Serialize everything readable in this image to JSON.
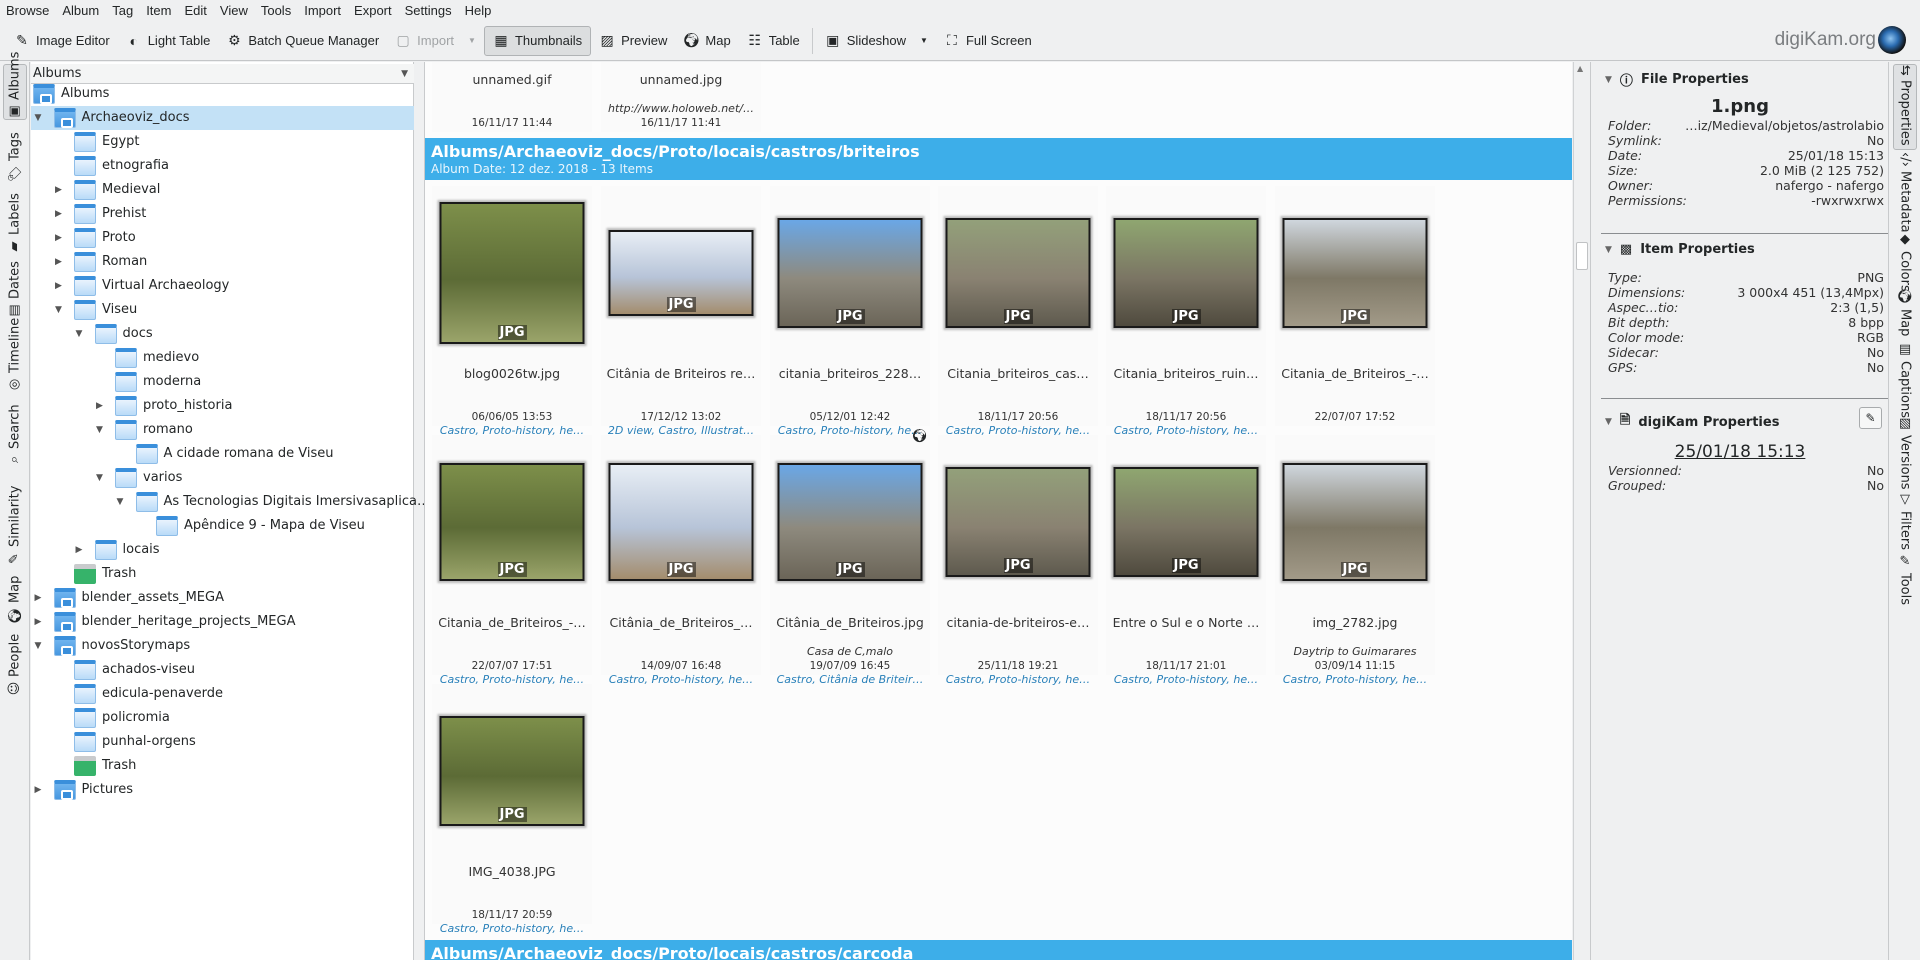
{
  "menu": [
    "Browse",
    "Album",
    "Tag",
    "Item",
    "Edit",
    "View",
    "Tools",
    "Import",
    "Export",
    "Settings",
    "Help"
  ],
  "toolbar": {
    "image_editor": "Image Editor",
    "light_table": "Light Table",
    "batch_queue": "Batch Queue Manager",
    "import": "Import",
    "thumbnails": "Thumbnails",
    "preview": "Preview",
    "map": "Map",
    "table": "Table",
    "slideshow": "Slideshow",
    "full_screen": "Full Screen",
    "logo_text": "digiKam.org"
  },
  "left_tabs": [
    "Albums",
    "Tags",
    "Labels",
    "Dates",
    "Timeline",
    "Search",
    "Similarity",
    "Map",
    "People"
  ],
  "tree": {
    "combo": "Albums",
    "items": [
      {
        "label": "Albums",
        "level": 0,
        "exp": "",
        "icon": "root"
      },
      {
        "label": "Archaeoviz_docs",
        "level": 1,
        "exp": "open",
        "icon": "root",
        "selected": true
      },
      {
        "label": "Egypt",
        "level": 2,
        "exp": "",
        "icon": "folder"
      },
      {
        "label": "etnografia",
        "level": 2,
        "exp": "",
        "icon": "folder"
      },
      {
        "label": "Medieval",
        "level": 2,
        "exp": "closed",
        "icon": "folder"
      },
      {
        "label": "Prehist",
        "level": 2,
        "exp": "closed",
        "icon": "folder"
      },
      {
        "label": "Proto",
        "level": 2,
        "exp": "closed",
        "icon": "folder"
      },
      {
        "label": "Roman",
        "level": 2,
        "exp": "closed",
        "icon": "folder"
      },
      {
        "label": "Virtual Archaeology",
        "level": 2,
        "exp": "closed",
        "icon": "folder"
      },
      {
        "label": "Viseu",
        "level": 2,
        "exp": "open",
        "icon": "folder"
      },
      {
        "label": "docs",
        "level": 3,
        "exp": "open",
        "icon": "folder"
      },
      {
        "label": "medievo",
        "level": 4,
        "exp": "",
        "icon": "folder"
      },
      {
        "label": "moderna",
        "level": 4,
        "exp": "",
        "icon": "folder"
      },
      {
        "label": "proto_historia",
        "level": 4,
        "exp": "closed",
        "icon": "folder"
      },
      {
        "label": "romano",
        "level": 4,
        "exp": "open",
        "icon": "folder"
      },
      {
        "label": "A cidade romana de Viseu",
        "level": 5,
        "exp": "",
        "icon": "folder"
      },
      {
        "label": "varios",
        "level": 4,
        "exp": "open",
        "icon": "folder"
      },
      {
        "label": "As Tecnologias Digitais Imersivasaplica…",
        "level": 5,
        "exp": "open",
        "icon": "folder"
      },
      {
        "label": "Apêndice 9 - Mapa de Viseu",
        "level": 6,
        "exp": "",
        "icon": "folder"
      },
      {
        "label": "locais",
        "level": 3,
        "exp": "closed",
        "icon": "folder"
      },
      {
        "label": "Trash",
        "level": 2,
        "exp": "",
        "icon": "trash"
      },
      {
        "label": "blender_assets_MEGA",
        "level": 1,
        "exp": "closed",
        "icon": "root"
      },
      {
        "label": "blender_heritage_projects_MEGA",
        "level": 1,
        "exp": "closed",
        "icon": "root"
      },
      {
        "label": "novosStorymaps",
        "level": 1,
        "exp": "open",
        "icon": "root"
      },
      {
        "label": "achados-viseu",
        "level": 2,
        "exp": "",
        "icon": "folder"
      },
      {
        "label": "edicula-penaverde",
        "level": 2,
        "exp": "",
        "icon": "folder"
      },
      {
        "label": "policromia",
        "level": 2,
        "exp": "",
        "icon": "folder"
      },
      {
        "label": "punhal-orgens",
        "level": 2,
        "exp": "",
        "icon": "folder"
      },
      {
        "label": "Trash",
        "level": 2,
        "exp": "",
        "icon": "trash"
      },
      {
        "label": "Pictures",
        "level": 1,
        "exp": "closed",
        "icon": "root"
      }
    ]
  },
  "prev_items": [
    {
      "name": "unnamed.gif",
      "caption": "",
      "date": "16/11/17 11:44"
    },
    {
      "name": "unnamed.jpg",
      "caption": "http://www.holoweb.net/…",
      "date": "16/11/17 11:41"
    }
  ],
  "album": {
    "title": "Albums/Archaeoviz_docs/Proto/locais/castros/briteiros",
    "subtitle": "Album Date: 12 dez. 2018 - 13 Items",
    "items": [
      {
        "name": "blog0026tw.jpg",
        "caption": "",
        "date": "06/06/05 13:53",
        "tags": "Castro, Proto-history, he…",
        "format": "JPG",
        "shape": "portrait"
      },
      {
        "name": "Citânia de Briteiros re…",
        "caption": "",
        "date": "17/12/12 13:02",
        "tags": "2D view, Castro, Illustrat…",
        "format": "JPG",
        "shape": "wide"
      },
      {
        "name": "citania_briteiros_228…",
        "caption": "",
        "date": "05/12/01 12:42",
        "tags": "Castro, Proto-history, he…",
        "format": "JPG",
        "shape": "landscape"
      },
      {
        "name": "Citania_briteiros_cas…",
        "caption": "",
        "date": "18/11/17 20:56",
        "tags": "Castro, Proto-history, he…",
        "format": "JPG",
        "shape": "landscape"
      },
      {
        "name": "Citania_briteiros_ruin…",
        "caption": "",
        "date": "18/11/17 20:56",
        "tags": "Castro, Proto-history, he…",
        "format": "JPG",
        "shape": "landscape"
      },
      {
        "name": "Citania_de_Briteiros_-…",
        "caption": "",
        "date": "22/07/07 17:52",
        "tags": "",
        "format": "JPG",
        "shape": "landscape"
      },
      {
        "name": "Citania_de_Briteiros_-…",
        "caption": "",
        "date": "22/07/07 17:51",
        "tags": "Castro, Proto-history, he…",
        "format": "JPG",
        "shape": "square"
      },
      {
        "name": "Citânia_de_Briteiros_…",
        "caption": "",
        "date": "14/09/07 16:48",
        "tags": "Castro, Proto-history, he…",
        "format": "JPG",
        "shape": "square"
      },
      {
        "name": "Citânia_de_Briteiros.jpg",
        "caption": "Casa de C,malo",
        "date": "19/07/09 16:45",
        "tags": "Castro, Citânia de Briteir…",
        "format": "JPG",
        "shape": "square",
        "gps": true
      },
      {
        "name": "citania-de-briteiros-e…",
        "caption": "",
        "date": "25/11/18 19:21",
        "tags": "Castro, Proto-history, he…",
        "format": "JPG",
        "shape": "landscape"
      },
      {
        "name": "Entre o Sul e o Norte …",
        "caption": "",
        "date": "18/11/17 21:01",
        "tags": "Castro, Proto-history, he…",
        "format": "JPG",
        "shape": "landscape"
      },
      {
        "name": "img_2782.jpg",
        "caption": "Daytrip to Guimarares",
        "date": "03/09/14 11:15",
        "tags": "Castro, Proto-history, he…",
        "format": "JPG",
        "shape": "square"
      },
      {
        "name": "IMG_4038.JPG",
        "caption": "",
        "date": "18/11/17 20:59",
        "tags": "Castro, Proto-history, he…",
        "format": "JPG",
        "shape": "landscape"
      }
    ]
  },
  "next_album": {
    "title": "Albums/Archaeoviz_docs/Proto/locais/castros/carcoda"
  },
  "properties": {
    "file_title": "File Properties",
    "filename": "1.png",
    "file_rows": [
      {
        "k": "Folder:",
        "v": "…iz/Medieval/objetos/astrolabio"
      },
      {
        "k": "Symlink:",
        "v": "No"
      },
      {
        "k": "Date:",
        "v": "25/01/18 15:13"
      },
      {
        "k": "Size:",
        "v": "2.0 MiB (2 125 752)"
      },
      {
        "k": "Owner:",
        "v": "nafergo - nafergo"
      },
      {
        "k": "Permissions:",
        "v": "-rwxrwxrwx"
      }
    ],
    "item_title": "Item Properties",
    "item_rows": [
      {
        "k": "Type:",
        "v": "PNG"
      },
      {
        "k": "Dimensions:",
        "v": "3 000x4 451 (13,4Mpx)"
      },
      {
        "k": "Aspec…tio:",
        "v": "2:3 (1,5)"
      },
      {
        "k": "Bit depth:",
        "v": "8 bpp"
      },
      {
        "k": "Color mode:",
        "v": "RGB"
      },
      {
        "k": "Sidecar:",
        "v": "No"
      },
      {
        "k": "GPS:",
        "v": "No"
      }
    ],
    "dk_title": "digiKam Properties",
    "dk_date": "25/01/18 15:13",
    "dk_rows": [
      {
        "k": "Versionned:",
        "v": "No"
      },
      {
        "k": "Grouped:",
        "v": "No"
      }
    ]
  },
  "right_tabs": [
    "Properties",
    "Metadata",
    "Colors",
    "Map",
    "Captions",
    "Versions",
    "Filters",
    "Tools"
  ],
  "colors": {
    "accent": "#3daee9",
    "selection": "#c3e1f6",
    "tags": "#2980b9"
  }
}
